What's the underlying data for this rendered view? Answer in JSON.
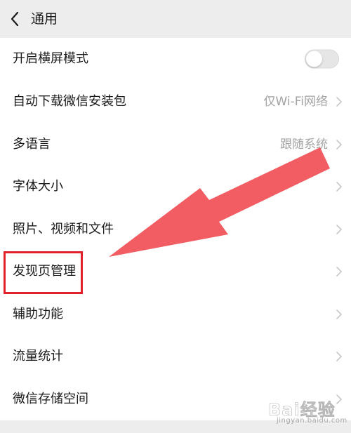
{
  "header": {
    "title": "通用",
    "back_icon": "chevron-left-icon"
  },
  "settings": [
    {
      "label": "开启横屏模式",
      "control": "toggle",
      "toggle_on": false
    },
    {
      "label": "自动下载微信安装包",
      "value": "仅Wi-Fi网络",
      "control": "chevron"
    },
    {
      "label": "多语言",
      "value": "跟随系统",
      "control": "chevron"
    },
    {
      "label": "字体大小",
      "control": "chevron"
    },
    {
      "label": "照片、视频和文件",
      "control": "chevron"
    },
    {
      "label": "发现页管理",
      "control": "chevron",
      "highlighted": true
    },
    {
      "label": "辅助功能",
      "control": "chevron"
    },
    {
      "label": "流量统计",
      "control": "chevron"
    },
    {
      "label": "微信存储空间",
      "control": "chevron"
    }
  ],
  "annotation": {
    "arrow_color": "#f0565c",
    "highlight_color": "#e1212b",
    "points_to": "发现页管理"
  },
  "watermark": {
    "logo_text": "Bai经验",
    "url_text": "jingyan.baidu.com"
  },
  "colors": {
    "background": "#ededed",
    "row_background": "#ffffff",
    "label_text": "#1a1a1a",
    "value_text": "#a3a3a3"
  }
}
